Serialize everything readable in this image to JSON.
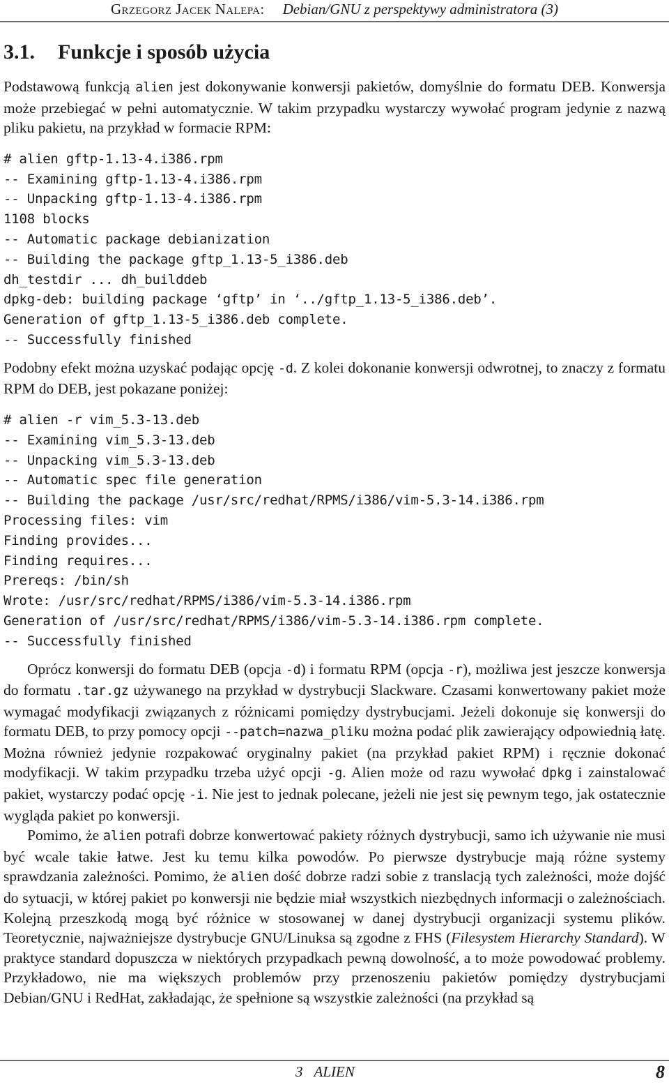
{
  "header": {
    "author": "Grzegorz Jacek Nalepa:",
    "title": "Debian/GNU z perspektywy administratora (3)"
  },
  "heading": {
    "number": "3.1.",
    "text": "Funkcje i sposób użycia"
  },
  "paragraphs": {
    "intro_1": "Podstawową funkcją ",
    "intro_1_code": "alien",
    "intro_1_rest": " jest dokonywanie konwersji pakietów, domyślnie do formatu DEB. Konwersja może przebiegać w pełni automatycznie. W takim przypadku wystarczy wywołać program jedynie z nazwą pliku pakietu, na przykład w formacie RPM:",
    "between_a": "Podobny efekt można uzyskać podając opcję ",
    "between_code": "-d",
    "between_b": ". Z kolei dokonanie konwersji odwrotnej, to znaczy z formatu RPM do DEB, jest pokazane poniżej:",
    "p3_a": "Oprócz konwersji do formatu DEB (opcja ",
    "p3_c1": "-d",
    "p3_b": ") i formatu RPM (opcja ",
    "p3_c2": "-r",
    "p3_c": "), możliwa jest jeszcze konwersja do formatu ",
    "p3_c3": ".tar.gz",
    "p3_d": " używanego na przykład w dystrybucji Slackware. Czasami konwertowany pakiet może wymagać modyfikacji związanych z różnicami pomiędzy dystrybucjami. Jeżeli dokonuje się konwersji do formatu DEB, to przy pomocy opcji ",
    "p3_c4": "--patch=nazwa_pliku",
    "p3_e": " można podać plik zawierający odpowiednią łatę. Można również jedynie rozpakować oryginalny pakiet (na przykład pakiet RPM) i ręcznie dokonać modyfikacji. W takim przypadku trzeba użyć opcji ",
    "p3_c5": "-g",
    "p3_f": ". Alien może od razu wywołać ",
    "p3_c6": "dpkg",
    "p3_g": " i zainstalować pakiet, wystarczy podać opcję ",
    "p3_c7": "-i",
    "p3_h": ". Nie jest to jednak polecane, jeżeli nie jest się pewnym tego, jak ostatecznie wygląda pakiet po konwersji.",
    "p4_a": "Pomimo, że ",
    "p4_c1": "alien",
    "p4_b": " potrafi dobrze konwertować pakiety różnych dystrybucji, samo ich używanie nie musi być wcale takie łatwe. Jest ku temu kilka powodów. Po pierwsze dystrybucje mają różne systemy sprawdzania zależności. Pomimo, że ",
    "p4_c2": "alien",
    "p4_c": " dość dobrze radzi sobie z translacją tych zależności, może dojść do sytuacji, w której pakiet po konwersji nie będzie miał wszystkich niezbędnych informacji o zależnościach. Kolejną przeszkodą mogą być różnice w stosowanej w danej dystrybucji organizacji systemu plików. Teoretycznie, najważniejsze dystrybucje GNU/Linuksa są zgodne z FHS (",
    "p4_italic": "Filesystem Hierarchy Standard",
    "p4_d": "). W praktyce standard dopuszcza w niektórych przypadkach pewną dowolność, a to może powodować problemy. Przykładowo, nie ma większych problemów przy przenoszeniu pakietów pomiędzy dystrybucjami Debian/GNU i RedHat, zakładając, że spełnione są wszystkie zależności (na przykład są"
  },
  "code_block_1": "# alien gftp-1.13-4.i386.rpm\n-- Examining gftp-1.13-4.i386.rpm\n-- Unpacking gftp-1.13-4.i386.rpm\n1108 blocks\n-- Automatic package debianization\n-- Building the package gftp_1.13-5_i386.deb\ndh_testdir ... dh_builddeb\ndpkg-deb: building package ‘gftp’ in ‘../gftp_1.13-5_i386.deb’.\nGeneration of gftp_1.13-5_i386.deb complete.\n-- Successfully finished",
  "code_block_2": "# alien -r vim_5.3-13.deb\n-- Examining vim_5.3-13.deb\n-- Unpacking vim_5.3-13.deb\n-- Automatic spec file generation\n-- Building the package /usr/src/redhat/RPMS/i386/vim-5.3-14.i386.rpm\nProcessing files: vim\nFinding provides...\nFinding requires...\nPrereqs: /bin/sh\nWrote: /usr/src/redhat/RPMS/i386/vim-5.3-14.i386.rpm\nGeneration of /usr/src/redhat/RPMS/i386/vim-5.3-14.i386.rpm complete.\n-- Successfully finished",
  "footer": {
    "chapter_number": "3",
    "chapter_name": "ALIEN",
    "page_number": "8"
  }
}
